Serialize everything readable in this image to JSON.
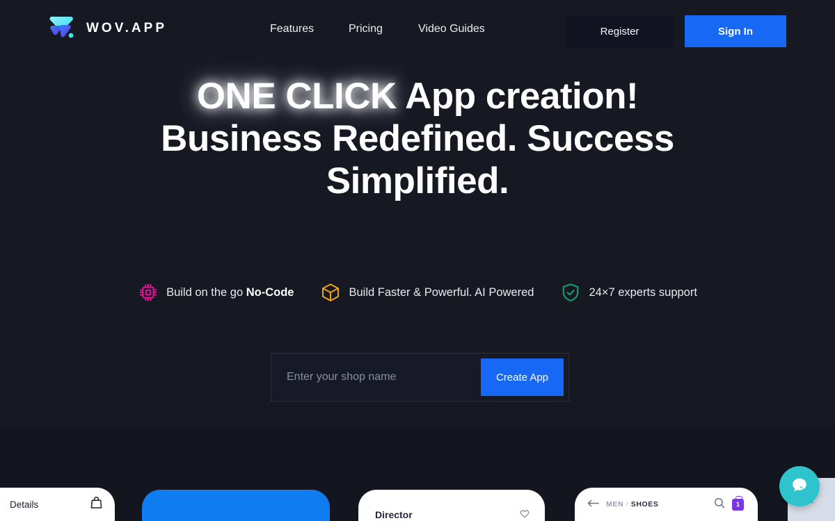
{
  "brand": {
    "name": "WOV.APP",
    "logo_icon": "wov-chevron-logo"
  },
  "nav": {
    "items": [
      {
        "label": "Features"
      },
      {
        "label": "Pricing"
      },
      {
        "label": "Video Guides"
      }
    ]
  },
  "auth": {
    "register_label": "Register",
    "signin_label": "Sign In",
    "signin_color": "#1668f5"
  },
  "hero": {
    "headline_highlight": "ONE CLICK",
    "headline_rest": " App creation!",
    "headline_line2": "Business Redefined. Success",
    "headline_line3": "Simplified."
  },
  "badges": [
    {
      "icon": "cpu-chip-icon",
      "icon_color": "#e8119b",
      "text_plain": "Build on the go ",
      "text_bold": "No-Code"
    },
    {
      "icon": "cube-box-icon",
      "icon_color": "#f0a31b",
      "text_plain": "Build Faster & Powerful. AI Powered",
      "text_bold": ""
    },
    {
      "icon": "shield-check-icon",
      "icon_color": "#10a674",
      "text_plain": "24×7 experts support",
      "text_bold": ""
    }
  ],
  "cta": {
    "placeholder": "Enter your shop name",
    "value": "",
    "button_label": "Create App",
    "button_color": "#1668f5"
  },
  "showcase": {
    "card_details": {
      "label": "Details",
      "icon": "shopping-bag-icon"
    },
    "card_blue": {
      "color": "#0f7df0"
    },
    "card_product": {
      "title": "Director",
      "fav_icon": "heart-icon"
    },
    "card_shop": {
      "back_icon": "arrow-left-icon",
      "crumb_category": "MEN",
      "crumb_separator": "/",
      "crumb_current": "SHOES",
      "search_icon": "search-icon",
      "bag_icon": "shopping-bag-icon",
      "bag_count": "1",
      "bag_color": "#7b35e0"
    }
  },
  "chat": {
    "bubble_icon": "chat-bubble-icon",
    "bubble_color": "#2ec4cd",
    "collapse_icon": "chevron-left-icon",
    "collapse_glyph": "‹"
  }
}
